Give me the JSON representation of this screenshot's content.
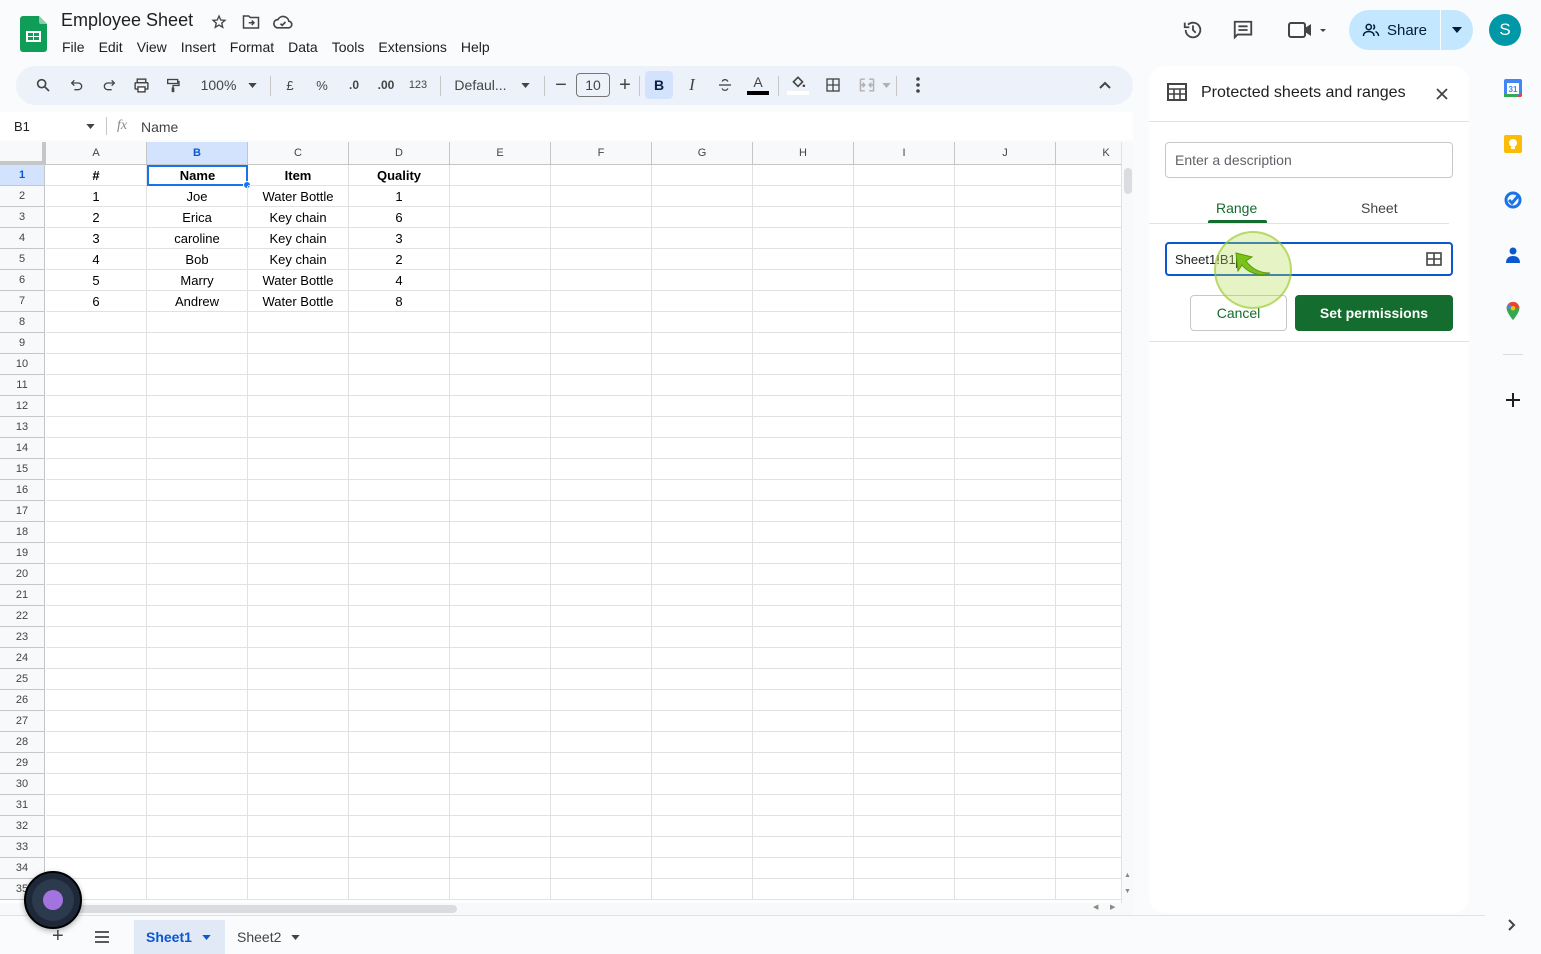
{
  "app": {
    "doc_title": "Employee Sheet",
    "menu": [
      "File",
      "Edit",
      "View",
      "Insert",
      "Format",
      "Data",
      "Tools",
      "Extensions",
      "Help"
    ],
    "share_label": "Share",
    "avatar_letter": "S",
    "brand_color": "#0f9d58"
  },
  "toolbar": {
    "zoom": "100%",
    "currency": "£",
    "percent": "%",
    "decrease_decimal": ".0",
    "increase_decimal": ".00",
    "number_format": "123",
    "font": "Defaul...",
    "font_size": "10"
  },
  "formula_bar": {
    "cell_ref": "B1",
    "fx": "fx",
    "value": "Name"
  },
  "grid": {
    "columns": [
      "A",
      "B",
      "C",
      "D",
      "E",
      "F",
      "G",
      "H",
      "I",
      "J",
      "K"
    ],
    "selected_column": "B",
    "selected_row": 1,
    "header_row": [
      "#",
      "Name",
      "Item",
      "Quality"
    ],
    "rows": [
      [
        "1",
        "Joe",
        "Water Bottle",
        "1"
      ],
      [
        "2",
        "Erica",
        "Key chain",
        "6"
      ],
      [
        "3",
        "caroline",
        "Key chain",
        "3"
      ],
      [
        "4",
        "Bob",
        "Key chain",
        "2"
      ],
      [
        "5",
        "Marry",
        "Water Bottle",
        "4"
      ],
      [
        "6",
        "Andrew",
        "Water Bottle",
        "8"
      ]
    ],
    "visible_row_count": 35
  },
  "panel": {
    "title": "Protected sheets and ranges",
    "description_placeholder": "Enter a description",
    "tabs": [
      "Range",
      "Sheet"
    ],
    "active_tab": "Range",
    "range_value": "Sheet1!B1",
    "cancel_label": "Cancel",
    "set_permissions_label": "Set permissions",
    "accent_color": "#146c2e"
  },
  "sheets": {
    "tabs": [
      "Sheet1",
      "Sheet2"
    ],
    "active": "Sheet1"
  }
}
